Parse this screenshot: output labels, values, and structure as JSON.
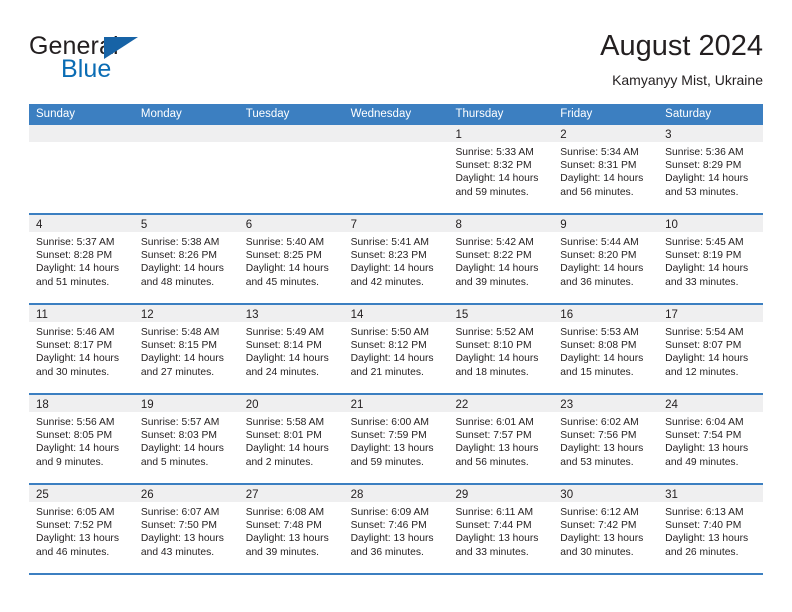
{
  "brand": {
    "name_part1": "General",
    "name_part2": "Blue",
    "flag_icon": "triangle-flag-icon"
  },
  "header": {
    "title": "August 2024",
    "subtitle": "Kamyanyy Mist, Ukraine"
  },
  "colors": {
    "header_blue": "#3c7fc1",
    "brand_blue": "#0a6cb4",
    "daynum_band": "#efeff0",
    "text": "#231f20"
  },
  "weekdays": [
    "Sunday",
    "Monday",
    "Tuesday",
    "Wednesday",
    "Thursday",
    "Friday",
    "Saturday"
  ],
  "weeks": [
    [
      {
        "day": "",
        "lines": []
      },
      {
        "day": "",
        "lines": []
      },
      {
        "day": "",
        "lines": []
      },
      {
        "day": "",
        "lines": []
      },
      {
        "day": "1",
        "lines": [
          "Sunrise: 5:33 AM",
          "Sunset: 8:32 PM",
          "Daylight: 14 hours",
          "and 59 minutes."
        ]
      },
      {
        "day": "2",
        "lines": [
          "Sunrise: 5:34 AM",
          "Sunset: 8:31 PM",
          "Daylight: 14 hours",
          "and 56 minutes."
        ]
      },
      {
        "day": "3",
        "lines": [
          "Sunrise: 5:36 AM",
          "Sunset: 8:29 PM",
          "Daylight: 14 hours",
          "and 53 minutes."
        ]
      }
    ],
    [
      {
        "day": "4",
        "lines": [
          "Sunrise: 5:37 AM",
          "Sunset: 8:28 PM",
          "Daylight: 14 hours",
          "and 51 minutes."
        ]
      },
      {
        "day": "5",
        "lines": [
          "Sunrise: 5:38 AM",
          "Sunset: 8:26 PM",
          "Daylight: 14 hours",
          "and 48 minutes."
        ]
      },
      {
        "day": "6",
        "lines": [
          "Sunrise: 5:40 AM",
          "Sunset: 8:25 PM",
          "Daylight: 14 hours",
          "and 45 minutes."
        ]
      },
      {
        "day": "7",
        "lines": [
          "Sunrise: 5:41 AM",
          "Sunset: 8:23 PM",
          "Daylight: 14 hours",
          "and 42 minutes."
        ]
      },
      {
        "day": "8",
        "lines": [
          "Sunrise: 5:42 AM",
          "Sunset: 8:22 PM",
          "Daylight: 14 hours",
          "and 39 minutes."
        ]
      },
      {
        "day": "9",
        "lines": [
          "Sunrise: 5:44 AM",
          "Sunset: 8:20 PM",
          "Daylight: 14 hours",
          "and 36 minutes."
        ]
      },
      {
        "day": "10",
        "lines": [
          "Sunrise: 5:45 AM",
          "Sunset: 8:19 PM",
          "Daylight: 14 hours",
          "and 33 minutes."
        ]
      }
    ],
    [
      {
        "day": "11",
        "lines": [
          "Sunrise: 5:46 AM",
          "Sunset: 8:17 PM",
          "Daylight: 14 hours",
          "and 30 minutes."
        ]
      },
      {
        "day": "12",
        "lines": [
          "Sunrise: 5:48 AM",
          "Sunset: 8:15 PM",
          "Daylight: 14 hours",
          "and 27 minutes."
        ]
      },
      {
        "day": "13",
        "lines": [
          "Sunrise: 5:49 AM",
          "Sunset: 8:14 PM",
          "Daylight: 14 hours",
          "and 24 minutes."
        ]
      },
      {
        "day": "14",
        "lines": [
          "Sunrise: 5:50 AM",
          "Sunset: 8:12 PM",
          "Daylight: 14 hours",
          "and 21 minutes."
        ]
      },
      {
        "day": "15",
        "lines": [
          "Sunrise: 5:52 AM",
          "Sunset: 8:10 PM",
          "Daylight: 14 hours",
          "and 18 minutes."
        ]
      },
      {
        "day": "16",
        "lines": [
          "Sunrise: 5:53 AM",
          "Sunset: 8:08 PM",
          "Daylight: 14 hours",
          "and 15 minutes."
        ]
      },
      {
        "day": "17",
        "lines": [
          "Sunrise: 5:54 AM",
          "Sunset: 8:07 PM",
          "Daylight: 14 hours",
          "and 12 minutes."
        ]
      }
    ],
    [
      {
        "day": "18",
        "lines": [
          "Sunrise: 5:56 AM",
          "Sunset: 8:05 PM",
          "Daylight: 14 hours",
          "and 9 minutes."
        ]
      },
      {
        "day": "19",
        "lines": [
          "Sunrise: 5:57 AM",
          "Sunset: 8:03 PM",
          "Daylight: 14 hours",
          "and 5 minutes."
        ]
      },
      {
        "day": "20",
        "lines": [
          "Sunrise: 5:58 AM",
          "Sunset: 8:01 PM",
          "Daylight: 14 hours",
          "and 2 minutes."
        ]
      },
      {
        "day": "21",
        "lines": [
          "Sunrise: 6:00 AM",
          "Sunset: 7:59 PM",
          "Daylight: 13 hours",
          "and 59 minutes."
        ]
      },
      {
        "day": "22",
        "lines": [
          "Sunrise: 6:01 AM",
          "Sunset: 7:57 PM",
          "Daylight: 13 hours",
          "and 56 minutes."
        ]
      },
      {
        "day": "23",
        "lines": [
          "Sunrise: 6:02 AM",
          "Sunset: 7:56 PM",
          "Daylight: 13 hours",
          "and 53 minutes."
        ]
      },
      {
        "day": "24",
        "lines": [
          "Sunrise: 6:04 AM",
          "Sunset: 7:54 PM",
          "Daylight: 13 hours",
          "and 49 minutes."
        ]
      }
    ],
    [
      {
        "day": "25",
        "lines": [
          "Sunrise: 6:05 AM",
          "Sunset: 7:52 PM",
          "Daylight: 13 hours",
          "and 46 minutes."
        ]
      },
      {
        "day": "26",
        "lines": [
          "Sunrise: 6:07 AM",
          "Sunset: 7:50 PM",
          "Daylight: 13 hours",
          "and 43 minutes."
        ]
      },
      {
        "day": "27",
        "lines": [
          "Sunrise: 6:08 AM",
          "Sunset: 7:48 PM",
          "Daylight: 13 hours",
          "and 39 minutes."
        ]
      },
      {
        "day": "28",
        "lines": [
          "Sunrise: 6:09 AM",
          "Sunset: 7:46 PM",
          "Daylight: 13 hours",
          "and 36 minutes."
        ]
      },
      {
        "day": "29",
        "lines": [
          "Sunrise: 6:11 AM",
          "Sunset: 7:44 PM",
          "Daylight: 13 hours",
          "and 33 minutes."
        ]
      },
      {
        "day": "30",
        "lines": [
          "Sunrise: 6:12 AM",
          "Sunset: 7:42 PM",
          "Daylight: 13 hours",
          "and 30 minutes."
        ]
      },
      {
        "day": "31",
        "lines": [
          "Sunrise: 6:13 AM",
          "Sunset: 7:40 PM",
          "Daylight: 13 hours",
          "and 26 minutes."
        ]
      }
    ]
  ]
}
